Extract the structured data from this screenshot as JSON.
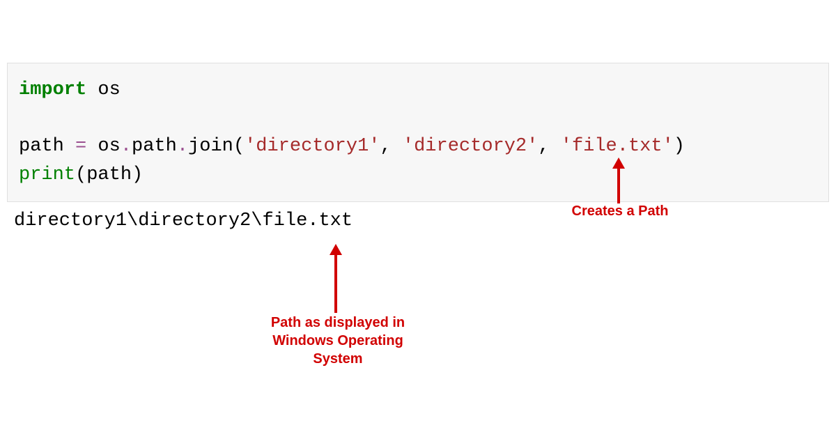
{
  "code": {
    "line1": {
      "import_kw": "import",
      "module": " os"
    },
    "line2_blank": "",
    "line3": {
      "var": "path ",
      "eq": "=",
      "obj": " os",
      "dot1": ".",
      "path_attr": "path",
      "dot2": ".",
      "join_fn": "join",
      "paren_open": "(",
      "str1": "'directory1'",
      "comma1": ", ",
      "str2": "'directory2'",
      "comma2": ", ",
      "str3": "'file.txt'",
      "paren_close": ")"
    },
    "line4": {
      "print_fn": "print",
      "paren_open": "(",
      "arg": "path",
      "paren_close": ")"
    }
  },
  "output": "directory1\\directory2\\file.txt",
  "annotations": {
    "creates_path": "Creates a Path",
    "path_displayed": "Path as displayed in Windows Operating System"
  }
}
